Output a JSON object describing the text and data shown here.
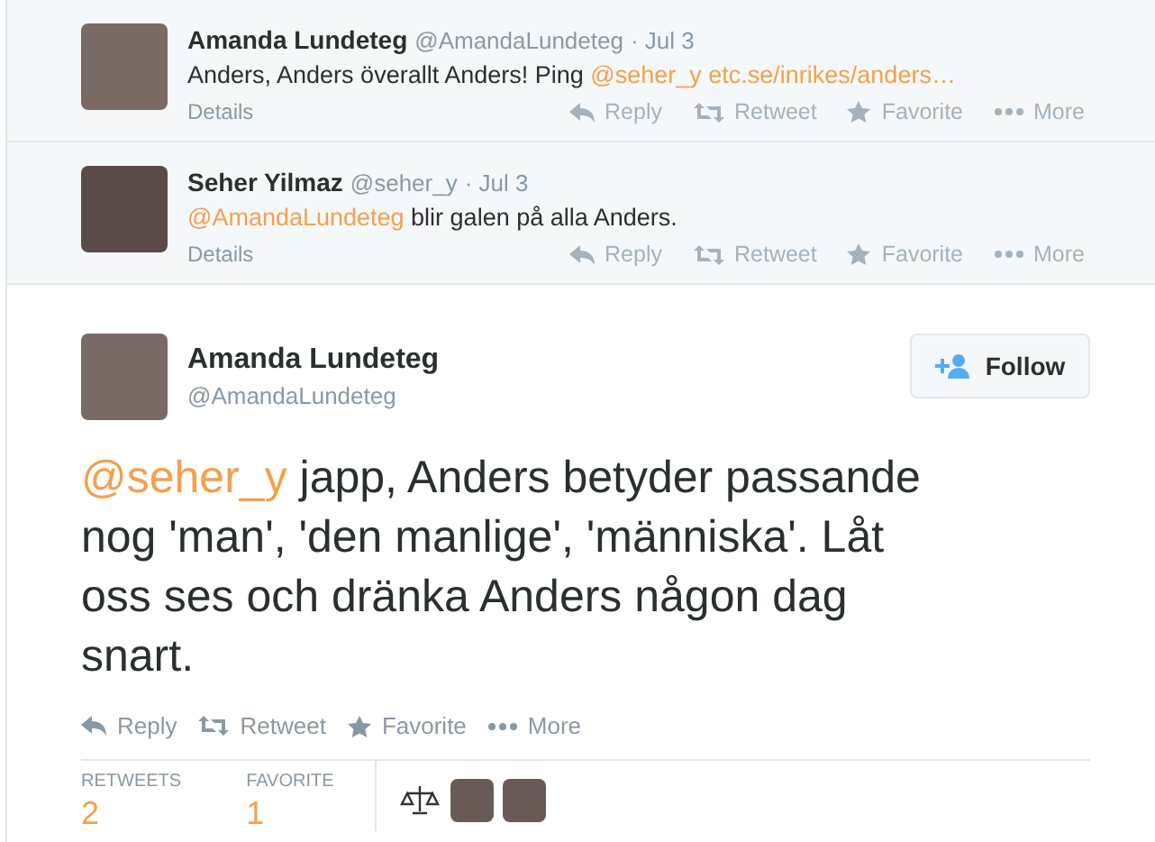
{
  "replies": [
    {
      "name": "Amanda Lundeteg",
      "handle": "@AmandaLundeteg",
      "time": "· Jul 3",
      "text": [
        {
          "kind": "plain",
          "text": "Anders, Anders överallt Anders! Ping "
        },
        {
          "kind": "mention",
          "text": "@seher_y"
        },
        {
          "kind": "link",
          "text": "etc.se/inrikes/anders…"
        }
      ],
      "details": "Details",
      "actions": [
        "Reply",
        "Retweet",
        "Favorite",
        "More"
      ]
    },
    {
      "name": "Seher Yilmaz",
      "handle": "@seher_y",
      "time": "· Jul 3",
      "text": [
        {
          "kind": "mention",
          "text": "@AmandaLundeteg"
        },
        {
          "kind": "plain",
          "text": " blir galen på alla Anders."
        }
      ],
      "details": "Details",
      "actions": [
        "Reply",
        "Retweet",
        "Favorite",
        "More"
      ]
    }
  ],
  "main_tweet": {
    "name": "Amanda Lundeteg",
    "handle": "@AmandaLundeteg",
    "follow": "Follow",
    "text": [
      {
        "kind": "mention",
        "text": "@seher_y"
      },
      {
        "kind": "plain",
        "text": " japp, Anders betyder passande nog 'man', 'den manlige', 'människa'. Låt oss ses och dränka Anders någon dag snart."
      }
    ],
    "actions": [
      "Reply",
      "Retweet",
      "Favorite",
      "More"
    ],
    "stats": [
      {
        "label": "RETWEETS",
        "value": "2"
      },
      {
        "label": "FAVORITE",
        "value": "1"
      }
    ],
    "favoriters": [
      {
        "kind": "logo"
      },
      {
        "kind": "photo"
      },
      {
        "kind": "photo"
      }
    ]
  }
}
